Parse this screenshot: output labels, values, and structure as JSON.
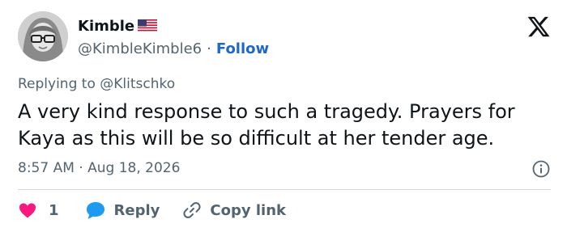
{
  "author": {
    "display_name": "Kimble",
    "handle": "@KimbleKimble6",
    "separator": "·",
    "follow_label": "Follow"
  },
  "reply_context": {
    "prefix": "Replying to",
    "mention": "@Klitschko"
  },
  "tweet": {
    "text": "A very kind response to such a tragedy. Prayers for Kaya as this will be so difficult at her tender age.",
    "time": "8:57 AM",
    "separator": "·",
    "date": "Aug 18, 2026"
  },
  "actions": {
    "like_count": "1",
    "reply_label": "Reply",
    "copy_link_label": "Copy link"
  },
  "colors": {
    "accent": "#1d68c8",
    "like": "#f91880",
    "reply_icon": "#1d9bf0",
    "muted": "#536471",
    "text": "#0f1419"
  },
  "icons": [
    "us-flag-icon",
    "x-logo-icon",
    "info-icon",
    "heart-icon",
    "reply-bubble-icon",
    "link-icon"
  ]
}
